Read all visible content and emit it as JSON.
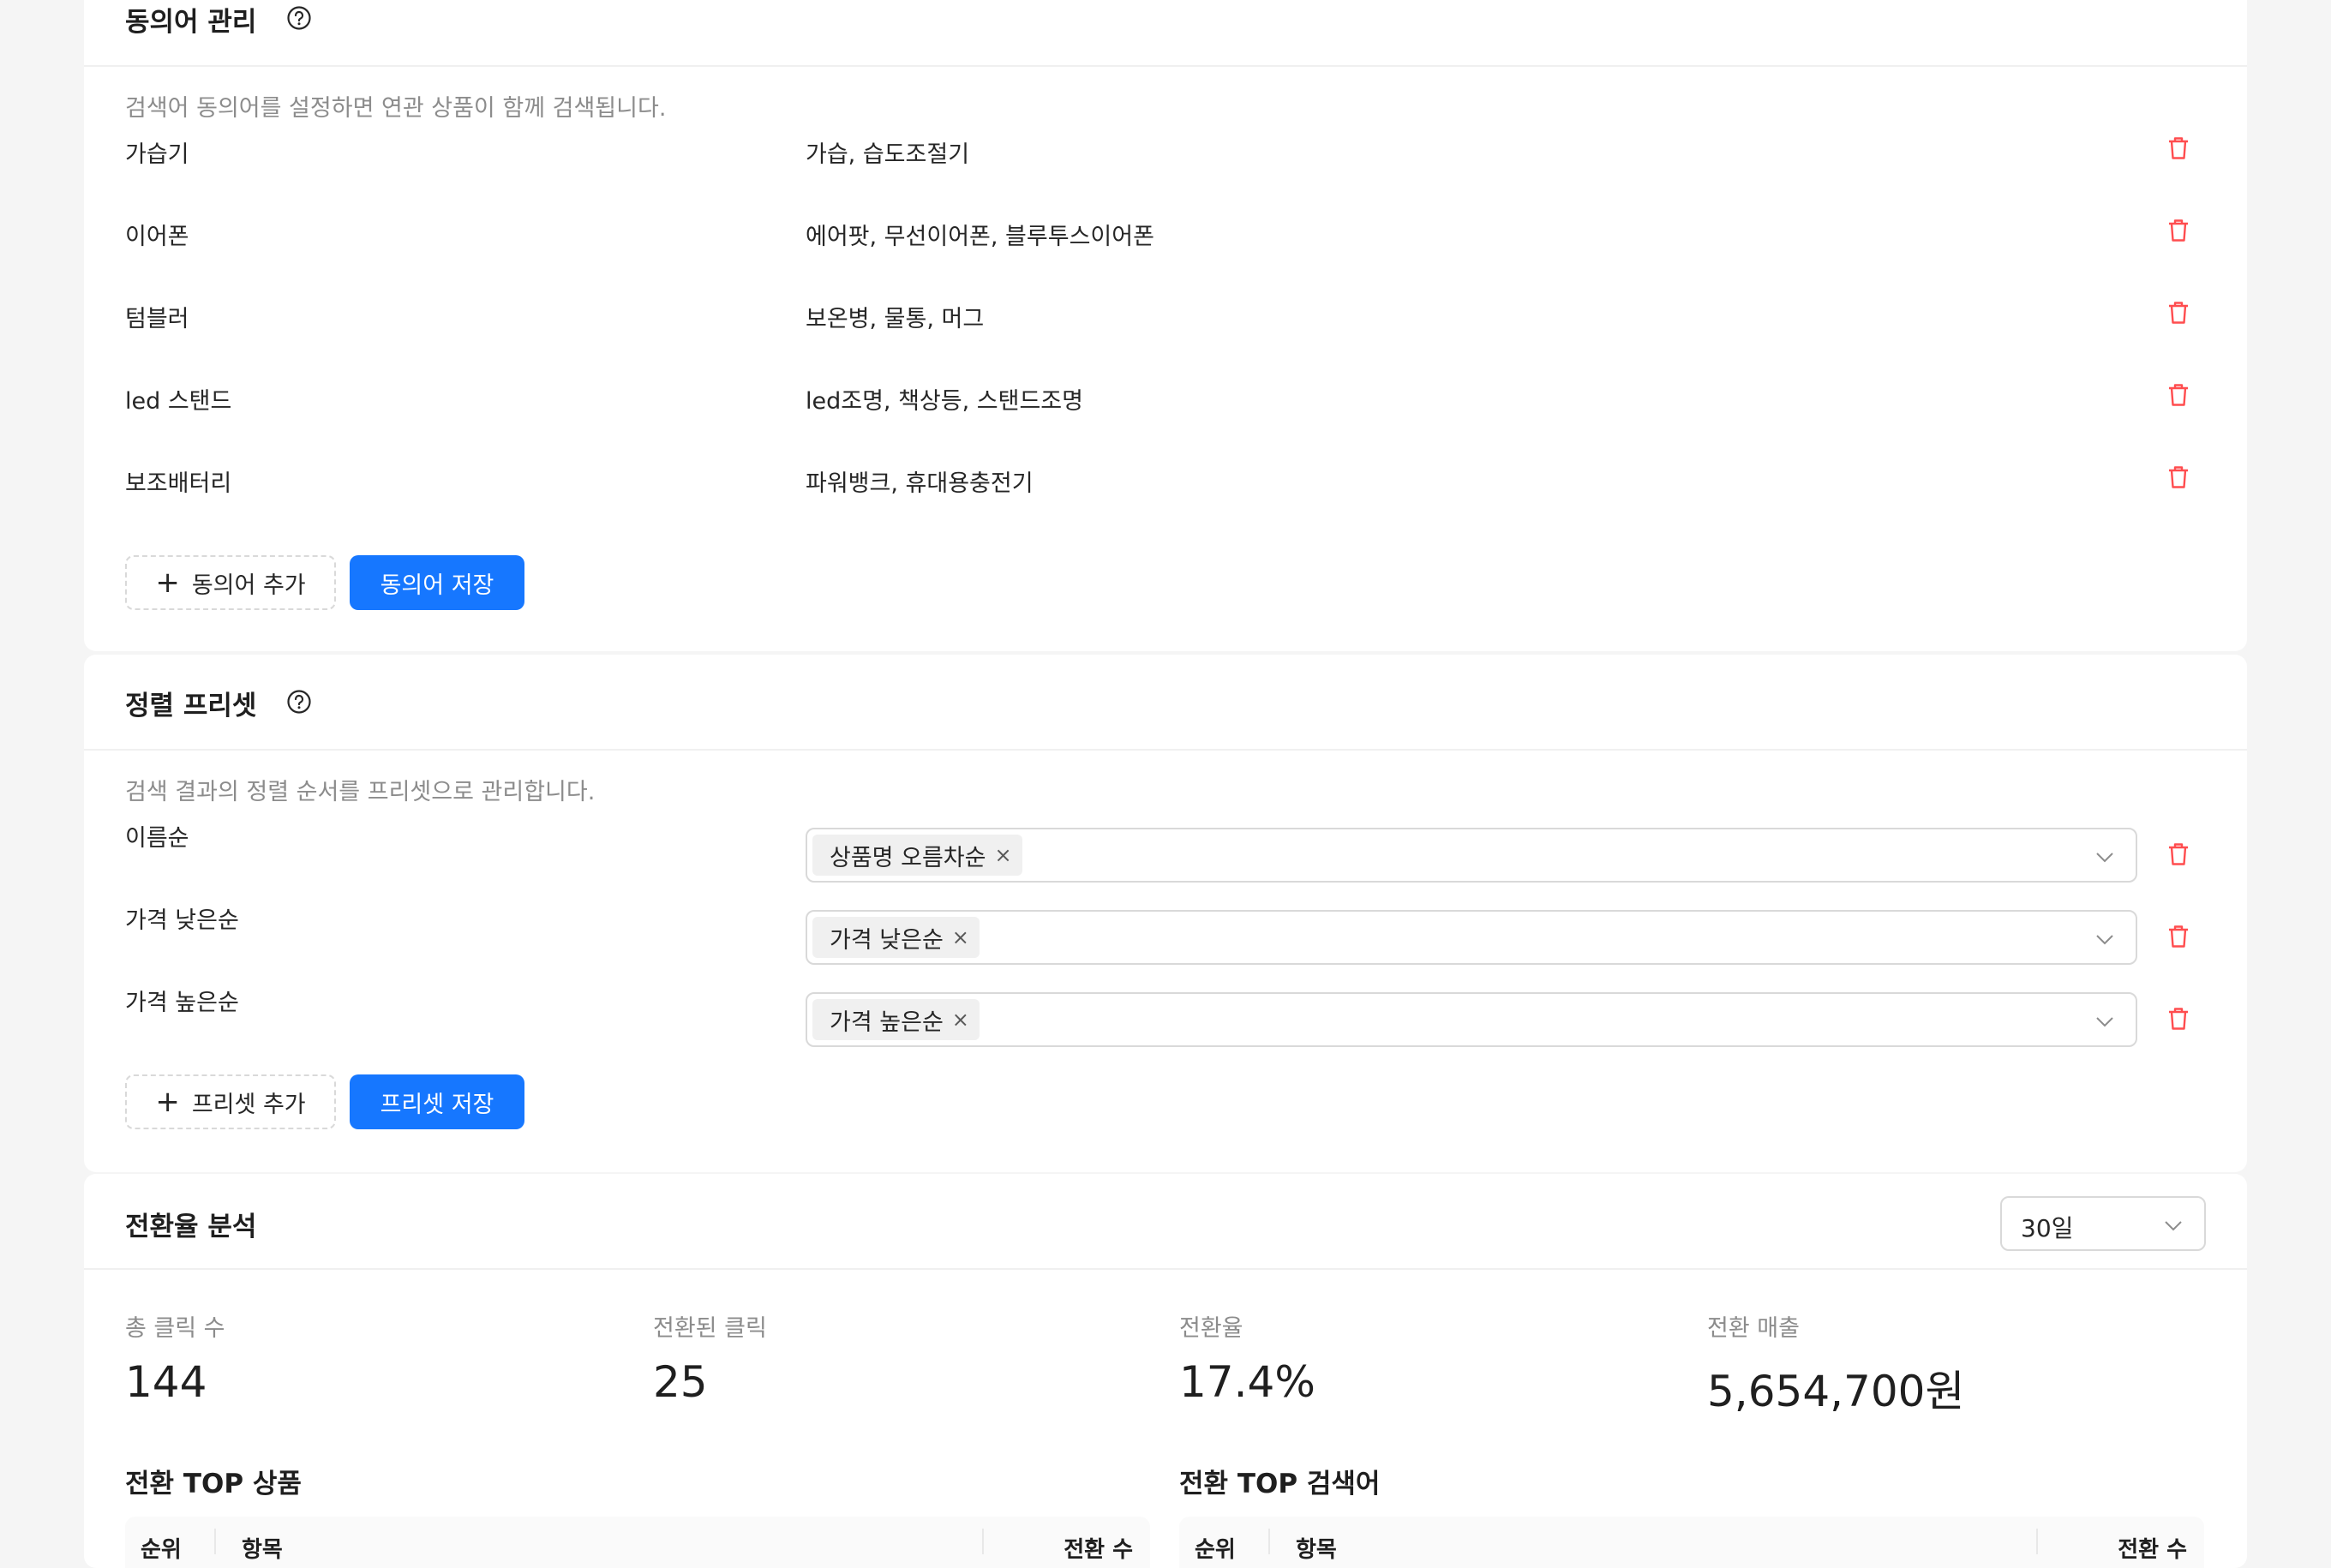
{
  "synonyms": {
    "title": "동의어 관리",
    "description": "검색어 동의어를 설정하면 연관 상품이 함께 검색됩니다.",
    "rows": [
      {
        "keyword": "가습기",
        "synonyms": "가습, 습도조절기"
      },
      {
        "keyword": "이어폰",
        "synonyms": "에어팟, 무선이어폰, 블루투스이어폰"
      },
      {
        "keyword": "텀블러",
        "synonyms": "보온병, 물통, 머그"
      },
      {
        "keyword": "led 스탠드",
        "synonyms": "led조명, 책상등, 스탠드조명"
      },
      {
        "keyword": "보조배터리",
        "synonyms": "파워뱅크, 휴대용충전기"
      }
    ],
    "add_label": "동의어 추가",
    "save_label": "동의어 저장"
  },
  "presets": {
    "title": "정렬 프리셋",
    "description": "검색 결과의 정렬 순서를 프리셋으로 관리합니다.",
    "rows": [
      {
        "name": "이름순",
        "tag": "상품명 오름차순"
      },
      {
        "name": "가격 낮은순",
        "tag": "가격 낮은순"
      },
      {
        "name": "가격 높은순",
        "tag": "가격 높은순"
      }
    ],
    "add_label": "프리셋 추가",
    "save_label": "프리셋 저장"
  },
  "conversion": {
    "title": "전환율 분석",
    "period": "30일",
    "stats": [
      {
        "label": "총 클릭 수",
        "value": "144"
      },
      {
        "label": "전환된 클릭",
        "value": "25"
      },
      {
        "label": "전환율",
        "value": "17.4%"
      },
      {
        "label": "전환 매출",
        "value": "5,654,700원"
      }
    ],
    "top_products": {
      "title": "전환 TOP 상품",
      "columns": [
        "순위",
        "항목",
        "전환 수"
      ]
    },
    "top_keywords": {
      "title": "전환 TOP 검색어",
      "columns": [
        "순위",
        "항목",
        "전환 수"
      ]
    }
  },
  "colors": {
    "primary": "#1677ff",
    "danger": "#ff4d4f",
    "muted": "#8c8c8c"
  }
}
